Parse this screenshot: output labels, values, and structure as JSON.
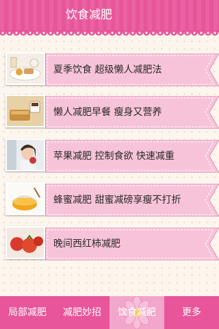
{
  "header": {
    "title": "饮食减肥"
  },
  "list": {
    "items": [
      {
        "label": "夏季饮食  超级懒人减肥法",
        "icon": "breakfast-plate-image"
      },
      {
        "label": "懒人减肥早餐 瘦身又营养",
        "icon": "bread-coffee-image"
      },
      {
        "label": "苹果减肥 控制食欲 快速减重",
        "icon": "woman-apple-image"
      },
      {
        "label": "蜂蜜减肥 甜蜜减磅享瘦不打折",
        "icon": "honey-jar-image"
      },
      {
        "label": "晚间西红柿减肥",
        "icon": "tomato-image"
      }
    ]
  },
  "tabs": [
    {
      "label": "局部减肥",
      "active": false
    },
    {
      "label": "减肥妙招",
      "active": false
    },
    {
      "label": "饮食减肥",
      "active": true
    },
    {
      "label": "更多",
      "active": false
    }
  ],
  "colors": {
    "header": "#e8559a",
    "ribbon": "#f7c3d8",
    "ribbon_border": "#e38fb5",
    "active_tab": "#f2a6cc",
    "background": "#fdf6ee"
  }
}
